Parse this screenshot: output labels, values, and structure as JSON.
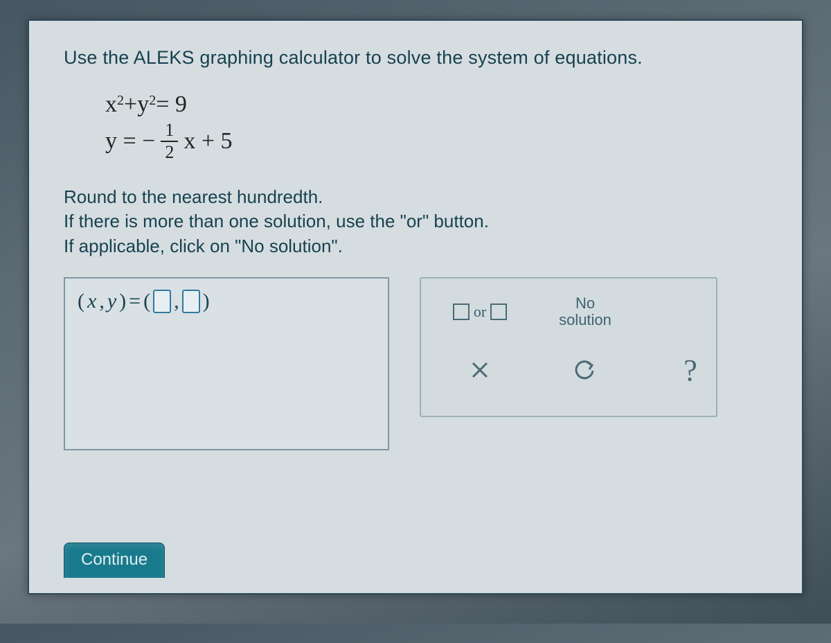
{
  "instruction": "Use the ALEKS graphing calculator to solve the system of equations.",
  "equations": {
    "eq1": {
      "lhs_a": "x",
      "sup_a": "2",
      "plus": "+",
      "lhs_b": "y",
      "sup_b": "2",
      "rhs": "= 9"
    },
    "eq2": {
      "lhs": "y = −",
      "frac_num": "1",
      "frac_den": "2",
      "after": "x + 5"
    }
  },
  "directions": {
    "line1": "Round to the nearest hundredth.",
    "line2": "If there is more than one solution, use the \"or\" button.",
    "line3": "If applicable, click on \"No solution\"."
  },
  "answer": {
    "prefix_open": "(",
    "var_x": "x",
    "comma": ", ",
    "var_y": "y",
    "prefix_close": ")",
    "equals": " = ",
    "paren_open": "(",
    "sep": ", ",
    "paren_close": ")"
  },
  "tools": {
    "or_label": "or",
    "no_solution_l1": "No",
    "no_solution_l2": "solution",
    "help_char": "?"
  },
  "continue_label": "Continue"
}
